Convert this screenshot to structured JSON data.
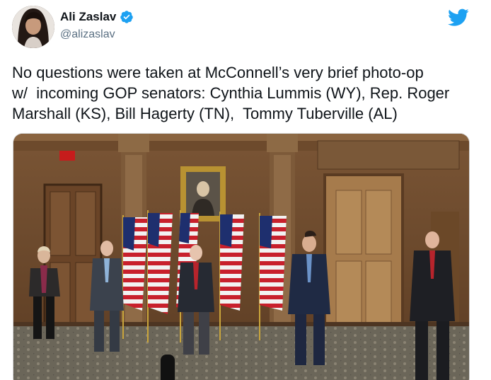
{
  "tweet": {
    "author": {
      "display_name": "Ali Zaslav",
      "handle": "@alizaslav",
      "verified": true
    },
    "text": "No questions were taken at McConnell’s very brief photo-op\nw/  incoming GOP senators: Cynthia Lummis (WY), Rep. Roger\nMarshall (KS), Bill Hagerty (TN),  Tommy Tuberville (AL)",
    "media": {
      "exit_sign": "EXIT"
    }
  },
  "colors": {
    "brand_blue": "#1da1f2",
    "text_primary": "#0f1419",
    "text_secondary": "#5b7083"
  },
  "icons": {
    "verified": "verified-badge-icon",
    "logo": "twitter-bird-icon"
  }
}
